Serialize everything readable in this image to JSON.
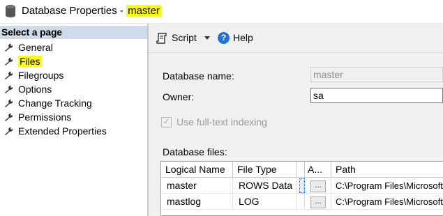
{
  "window": {
    "title_prefix": "Database Properties - ",
    "title_db": "master"
  },
  "sidebar": {
    "header": "Select a page",
    "items": [
      {
        "label": "General",
        "selected": false
      },
      {
        "label": "Files",
        "selected": true
      },
      {
        "label": "Filegroups",
        "selected": false
      },
      {
        "label": "Options",
        "selected": false
      },
      {
        "label": "Change Tracking",
        "selected": false
      },
      {
        "label": "Permissions",
        "selected": false
      },
      {
        "label": "Extended Properties",
        "selected": false
      }
    ]
  },
  "toolbar": {
    "script_label": "Script",
    "help_label": "Help"
  },
  "form": {
    "db_name_label": "Database name:",
    "db_name_value": "master",
    "owner_label": "Owner:",
    "owner_value": "sa",
    "fulltext_label": "Use full-text indexing",
    "fulltext_checked": true,
    "files_label": "Database files:"
  },
  "files_table": {
    "columns": [
      "Logical Name",
      "File Type",
      "",
      "A...",
      "Path"
    ],
    "rows": [
      {
        "logical_name": "master",
        "file_type": "ROWS Data",
        "button": "...",
        "path": "C:\\Program Files\\Microsoft"
      },
      {
        "logical_name": "mastlog",
        "file_type": "LOG",
        "button": "...",
        "path": "C:\\Program Files\\Microsoft"
      }
    ]
  },
  "colors": {
    "highlight": "#ffff00",
    "sidebar_header": "#cfdbe9",
    "panel": "#f0f0f0",
    "help_icon": "#1e72d8"
  }
}
